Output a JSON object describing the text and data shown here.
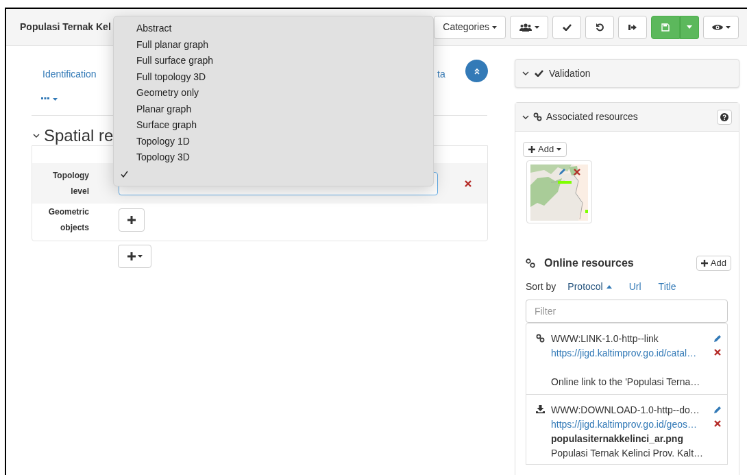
{
  "header": {
    "title": "Populasi Ternak Kel",
    "categories_button": "Categories"
  },
  "dropdown": {
    "items": [
      {
        "label": "Abstract",
        "selected": false
      },
      {
        "label": "Full planar graph",
        "selected": false
      },
      {
        "label": "Full surface graph",
        "selected": false
      },
      {
        "label": "Full topology 3D",
        "selected": false
      },
      {
        "label": "Geometry only",
        "selected": false
      },
      {
        "label": "Planar graph",
        "selected": false
      },
      {
        "label": "Surface graph",
        "selected": false
      },
      {
        "label": "Topology 1D",
        "selected": false
      },
      {
        "label": "Topology 3D",
        "selected": false
      },
      {
        "selected": true
      }
    ]
  },
  "tabs": [
    {
      "label": "Identification"
    },
    {
      "label": "ta"
    }
  ],
  "section": {
    "title": "Spatial re",
    "fields": [
      {
        "label": "Topology level",
        "kind": "select"
      },
      {
        "label": "Geometric objects",
        "kind": "add"
      }
    ]
  },
  "validation": {
    "title": "Validation"
  },
  "associated": {
    "title": "Associated resources",
    "add_button": "Add"
  },
  "online": {
    "title": "Online resources",
    "add_button": "Add",
    "sort_label": "Sort by",
    "sort_options": [
      {
        "label": "Protocol",
        "selected": true
      },
      {
        "label": "Url",
        "selected": false
      },
      {
        "label": "Title",
        "selected": false
      }
    ],
    "filter_placeholder": "Filter",
    "items": [
      {
        "kind": "link",
        "protocol": "WWW:LINK-1.0-http--link",
        "url": "https://jigd.kaltimprov.go.id/catal…",
        "description": "Online link to the 'Populasi Terna…"
      },
      {
        "kind": "download",
        "protocol": "WWW:DOWNLOAD-1.0-http--do…",
        "url": "https://jigd.kaltimprov.go.id/geos…",
        "name": "populasiternakkelinci_ar.png",
        "description": "Populasi Ternak Kelinci Prov. Kalt…"
      }
    ]
  }
}
